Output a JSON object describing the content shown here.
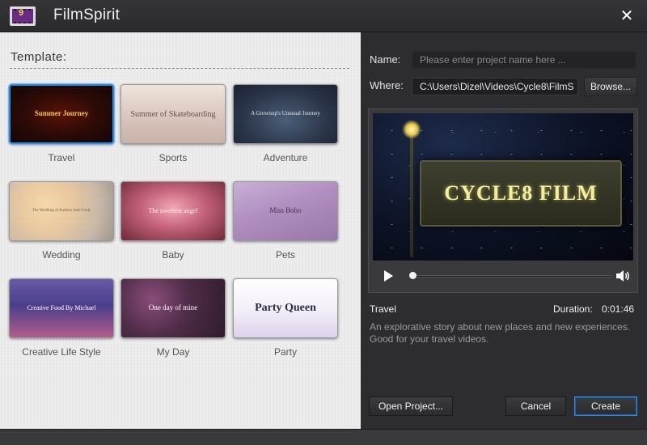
{
  "window": {
    "title": "FilmSpirit",
    "logo_glyph": "9",
    "close_glyph": "✕"
  },
  "templates_panel": {
    "heading": "Template:",
    "templates": [
      {
        "caption": "Travel",
        "thumb_title": "Summer Journey",
        "selected": true
      },
      {
        "caption": "Sports",
        "thumb_title": "Summer of Skateboarding"
      },
      {
        "caption": "Adventure",
        "thumb_title": "A Grownup's Unusual Journey"
      },
      {
        "caption": "Wedding",
        "thumb_title": "The Wedding of Andrew And Cindy"
      },
      {
        "caption": "Baby",
        "thumb_title": "The sweetest angel"
      },
      {
        "caption": "Pets",
        "thumb_title": "Miss Bobo"
      },
      {
        "caption": "Creative Life Style",
        "thumb_title": "Creative Food By Michael"
      },
      {
        "caption": "My Day",
        "thumb_title": "One day of mine"
      },
      {
        "caption": "Party",
        "thumb_title": "Party Queen"
      }
    ]
  },
  "project": {
    "name_label": "Name:",
    "name_placeholder": "Please enter project name here ...",
    "where_label": "Where:",
    "where_value": "C:\\Users\\Dizel\\Videos\\Cycle8\\FilmS",
    "browse_label": "Browse..."
  },
  "preview": {
    "video_title": "CYCLE8 FILM",
    "seek_progress": 0.0,
    "play_icon": "play-icon",
    "volume_icon": "volume-icon"
  },
  "info": {
    "template_name": "Travel",
    "duration_label": "Duration:",
    "duration_value": "0:01:46",
    "description": "An explorative story about new places and new experiences. Good for your travel videos."
  },
  "buttons": {
    "open_project": "Open Project...",
    "cancel": "Cancel",
    "create": "Create"
  },
  "colors": {
    "accent": "#2d8be5",
    "left_bg": "#ececec",
    "right_bg": "#2d2d2f"
  }
}
